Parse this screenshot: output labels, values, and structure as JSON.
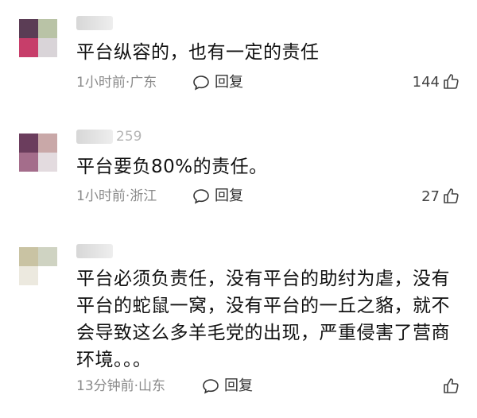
{
  "comments": [
    {
      "username_tail": "",
      "text": "平台纵容的，也有一定的责任",
      "meta": "1小时前·广东",
      "reply_label": "回复",
      "likes": "144",
      "avatar_colors": [
        "#5b3d55",
        "#b9c3a6",
        "#c73e6a",
        "#d9d4d8"
      ]
    },
    {
      "username_tail": "259",
      "text": "平台要负80%的责任。",
      "meta": "1小时前·浙江",
      "reply_label": "回复",
      "likes": "27",
      "avatar_colors": [
        "#6b3d5d",
        "#c9a8a8",
        "#a46d8b",
        "#e3dbdf"
      ]
    },
    {
      "username_tail": "",
      "text": "平台必须负责任，没有平台的助纣为虐，没有平台的蛇鼠一窝，没有平台的一丘之貉，就不会导致这么多羊毛党的出现，严重侵害了营商环境。。。",
      "meta": "13分钟前·山东",
      "reply_label": "回复",
      "likes": "",
      "avatar_colors": [
        "#c9c3a3",
        "#cfd3c2",
        "#ece9df",
        "#ffffff"
      ]
    }
  ],
  "icons": {
    "reply": "speech-bubble-icon",
    "like": "thumbs-up-icon"
  }
}
